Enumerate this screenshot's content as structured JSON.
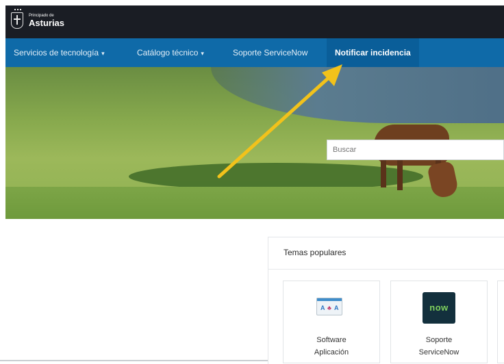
{
  "header": {
    "logo_small": "Principado de",
    "logo_big": "Asturias"
  },
  "nav": {
    "items": [
      {
        "label": "Servicios de tecnología",
        "dropdown": true
      },
      {
        "label": "Catálogo técnico",
        "dropdown": true
      },
      {
        "label": "Soporte ServiceNow",
        "dropdown": false
      },
      {
        "label": "Notificar incidencia",
        "dropdown": false,
        "active": true
      }
    ],
    "caret": "▾"
  },
  "search": {
    "placeholder": "Buscar"
  },
  "topics": {
    "title": "Temas populares",
    "cards": [
      {
        "line1": "Software",
        "line2": "Aplicación",
        "icon": "app-icon"
      },
      {
        "line1": "Soporte",
        "line2": "ServiceNow",
        "icon": "servicenow-icon",
        "icon_text": "now"
      }
    ]
  },
  "colors": {
    "topbar": "#1a1d24",
    "navbar": "#0f6aa8",
    "annotation_arrow": "#f2c21b",
    "now_logo_bg": "#13303d",
    "now_logo_text": "#7fd15d"
  }
}
